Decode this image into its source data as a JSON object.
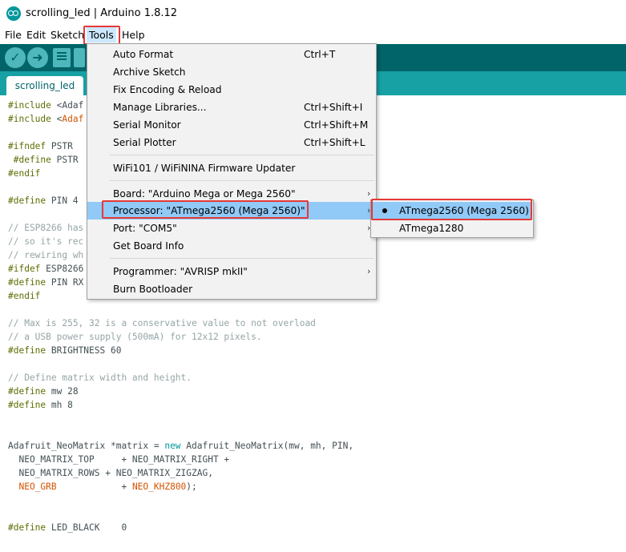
{
  "window": {
    "title": "scrolling_led | Arduino 1.8.12"
  },
  "menubar": {
    "file": "File",
    "edit": "Edit",
    "sketch": "Sketch",
    "tools": "Tools",
    "help": "Help"
  },
  "toolbar": {
    "verify": "✓",
    "upload": "➜"
  },
  "tab": {
    "name": "scrolling_led"
  },
  "code": {
    "l1a": "#include",
    "l1b": " <Adaf",
    "l2a": "#include",
    "l2b": " <",
    "l2c": "Adaf",
    "l3a": "#ifndef",
    "l3b": " PSTR",
    "l4a": " #define",
    "l4b": " PSTR",
    "l5": "#endif",
    "l6a": "#define",
    "l6b": " PIN 4",
    "l7": "// ESP8266 has",
    "l8": "// so it's rec",
    "l9": "// rewiring wh",
    "l10a": "#ifdef",
    "l10b": " ESP8266",
    "l11a": "#define",
    "l11b": " PIN RX",
    "l12": "#endif",
    "l13": "// Max is 255, 32 is a conservative value to not overload",
    "l14": "// a USB power supply (500mA) for 12x12 pixels.",
    "l15a": "#define",
    "l15b": " BRIGHTNESS 60",
    "l16": "// Define matrix width and height.",
    "l17a": "#define",
    "l17b": " mw 28",
    "l18a": "#define",
    "l18b": " mh 8",
    "l19a": "Adafruit_NeoMatrix *matrix = ",
    "l19b": "new",
    "l19c": " Adafruit_NeoMatrix(mw, mh, PIN,",
    "l20": "  NEO_MATRIX_TOP     + NEO_MATRIX_RIGHT +",
    "l21": "  NEO_MATRIX_ROWS + NEO_MATRIX_ZIGZAG,",
    "l22a": "  ",
    "l22b": "NEO_GRB",
    "l22c": "            + ",
    "l22d": "NEO_KHZ800",
    "l22e": ");",
    "l23a": "#define",
    "l23b": " LED_BLACK    0"
  },
  "tools_menu": {
    "auto_format": "Auto Format",
    "auto_format_sc": "Ctrl+T",
    "archive_sketch": "Archive Sketch",
    "fix_encoding": "Fix Encoding & Reload",
    "manage_libraries": "Manage Libraries...",
    "manage_libraries_sc": "Ctrl+Shift+I",
    "serial_monitor": "Serial Monitor",
    "serial_monitor_sc": "Ctrl+Shift+M",
    "serial_plotter": "Serial Plotter",
    "serial_plotter_sc": "Ctrl+Shift+L",
    "wifi_updater": "WiFi101 / WiFiNINA Firmware Updater",
    "board": "Board: \"Arduino Mega or Mega 2560\"",
    "processor": "Processor: \"ATmega2560 (Mega 2560)\"",
    "port": "Port: \"COM5\"",
    "board_info": "Get Board Info",
    "programmer": "Programmer: \"AVRISP mkII\"",
    "burn_bootloader": "Burn Bootloader",
    "arrow": "›"
  },
  "processor_submenu": {
    "selected": "ATmega2560 (Mega 2560)",
    "other": "ATmega1280"
  },
  "colors": {
    "toolbar": "#006468",
    "tabstrip": "#17a1a5",
    "highlight": "#91c9f7",
    "annotation": "#e53935"
  }
}
